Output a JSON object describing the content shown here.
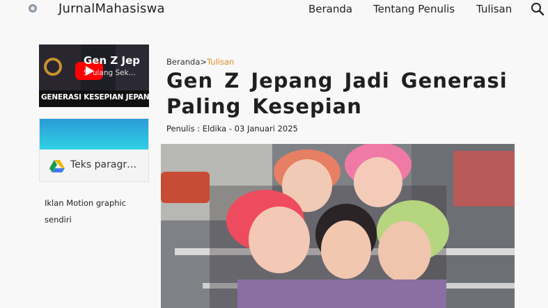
{
  "header": {
    "site_title": "JurnalMahasiswa",
    "nav": [
      "Beranda",
      "Tentang Penulis",
      "Tulisan"
    ],
    "logo_icon": "site-logo-icon",
    "search_icon": "search-icon"
  },
  "sidebar": {
    "video": {
      "title": "Gen Z Jep",
      "subtitle": "S•ulang Sek...",
      "banner": "GENERASI KESEPIAN JEPANG",
      "play_icon": "play-icon"
    },
    "card": {
      "text": "Teks paragr…",
      "icon": "google-drive-icon"
    },
    "caption": "Iklan Motion graphic sendiri"
  },
  "article": {
    "breadcrumb_home": "Beranda",
    "breadcrumb_sep": ">",
    "breadcrumb_current": "Tulisan",
    "title": "Gen Z Jepang Jadi Generasi Paling Kesepian",
    "byline": "Penulis : Eldika - 03 Januari 2025",
    "image_subject": "group of five friends with colorful hair posing on a street bridge"
  },
  "colors": {
    "accent": "#d9902a",
    "background": "#f8f8f8",
    "card_gradient_top": "#2a9bd6",
    "card_gradient_bottom": "#2fd0e6",
    "youtube_red": "#ff0000"
  }
}
